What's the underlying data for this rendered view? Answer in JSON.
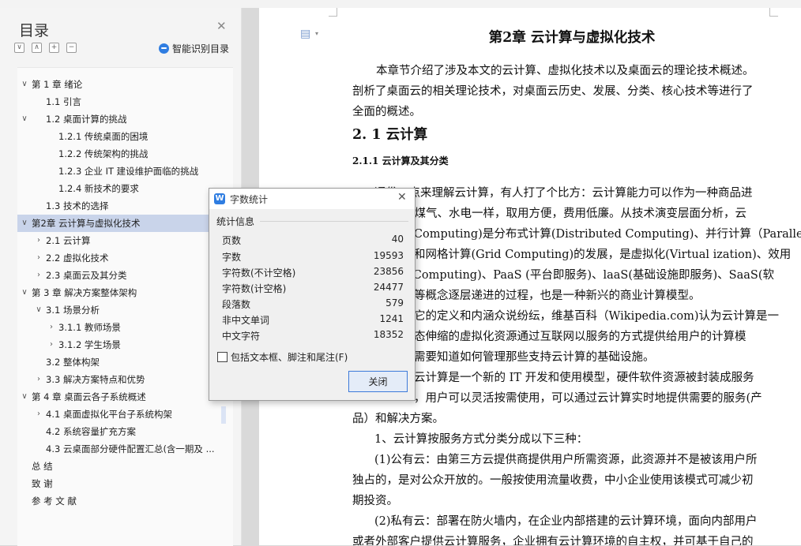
{
  "sidebar": {
    "title": "目录",
    "ai_button_label": "智能识别目录",
    "tools": [
      "∨",
      "∧",
      "+",
      "−"
    ],
    "items": [
      {
        "label": "第 1 章  绪论",
        "caret": "∨"
      },
      {
        "label": "1.1  引言",
        "caret": ""
      },
      {
        "label": "1.2  桌面计算的挑战",
        "caret": "∨"
      },
      {
        "label": "1.2.1  传统桌面的困境",
        "caret": ""
      },
      {
        "label": "1.2.2  传统架构的挑战",
        "caret": ""
      },
      {
        "label": "1.2.3  企业 IT 建设维护面临的挑战",
        "caret": ""
      },
      {
        "label": "1.2.4  新技术的要求",
        "caret": ""
      },
      {
        "label": "1.3  技术的选择",
        "caret": ""
      },
      {
        "label": "第2章  云计算与虚拟化技术",
        "caret": "∨"
      },
      {
        "label": "2.1  云计算",
        "caret": "›"
      },
      {
        "label": "2.2  虚拟化技术",
        "caret": "›"
      },
      {
        "label": "2.3  桌面云及其分类",
        "caret": "›"
      },
      {
        "label": "第 3 章  解决方案整体架构",
        "caret": "∨"
      },
      {
        "label": "3.1  场景分析",
        "caret": "∨"
      },
      {
        "label": "3.1.1 教师场景",
        "caret": "›"
      },
      {
        "label": "3.1.2 学生场景",
        "caret": "›"
      },
      {
        "label": "3.2 整体构架",
        "caret": ""
      },
      {
        "label": "3.3 解决方案特点和优势",
        "caret": "›"
      },
      {
        "label": "第 4 章  桌面云各子系统概述",
        "caret": "∨"
      },
      {
        "label": "4.1 桌面虚拟化平台子系统构架",
        "caret": "›"
      },
      {
        "label": "4.2 系统容量扩充方案",
        "caret": ""
      },
      {
        "label": "4.3 云桌面部分硬件配置汇总(含一期及 ...",
        "caret": ""
      },
      {
        "label": "总    结",
        "caret": ""
      },
      {
        "label": "致    谢",
        "caret": ""
      },
      {
        "label": "参  考  文  献",
        "caret": ""
      }
    ]
  },
  "document": {
    "chapter_title": "第2章  云计算与虚拟化技术",
    "intro_lines": [
      "本章节介绍了涉及本文的云计算、虚拟化技术以及桌面云的理论技术概述。",
      "剖析了桌面云的相关理论技术，对桌面云历史、发展、分类、核心技术等进行了",
      "全面的概述。"
    ],
    "section_heading": "2. 1    云计算",
    "subsection_heading": "2.1.1  云计算及其分类",
    "body_lines": [
      "通俗一点来理解云计算，有人打了个比方：云计算能力可以作为一种商品进",
      "像煤气、水电一样，取用方便，费用低廉。从技术演变层面分析，云",
      "d Computing)是分布式计算(Distributed Computing)、并行计算（Parallel",
      "和网格计算(Grid Computing)的发展，是虚拟化(Virtual ization)、效用",
      "y Computing)、PaaS (平台即服务)、laaS(基础设施即服务)、SaaS(软",
      "等概念逐层递进的过程，也是一种新兴的商业计算模型。",
      "它的定义和内涵众说纷纭，维基百科（Wikipedia.com)认为云计算是一",
      "态伸缩的虚拟化资源通过互联网以服务的方式提供给用户的计算模",
      "需要知道如何管理那些支持云计算的基础设施。",
      "云计算是一个新的 IT 开发和使用模型，硬件软件资源被封装成服务",
      "，用户可以灵活按需使用，可以通过云计算实时地提供需要的服务(产",
      "品）和解决方案。",
      "1、云计算按服务方式分类分成以下三种：",
      "(1)公有云：由第三方云提供商提供用户所需资源，此资源并不是被该用户所",
      "独占的，是对公众开放的。一般按使用流量收费，中小企业使用该模式可减少初",
      "期投资。",
      "(2)私有云：部署在防火墙内，在企业内部搭建的云计算环境，面向内部用户",
      "或者外部客户提供云计算服务，企业拥有云计算环境的自主权，并可基于自己的"
    ]
  },
  "dialog": {
    "title": "字数统计",
    "group_title": "统计信息",
    "stats": [
      {
        "label": "页数",
        "value": "40"
      },
      {
        "label": "字数",
        "value": "19593"
      },
      {
        "label": "字符数(不计空格)",
        "value": "23856"
      },
      {
        "label": "字符数(计空格)",
        "value": "24477"
      },
      {
        "label": "段落数",
        "value": "579"
      },
      {
        "label": "非中文单词",
        "value": "1241"
      },
      {
        "label": "中文字符",
        "value": "18352"
      }
    ],
    "checkbox_label": "包括文本框、脚注和尾注(F)",
    "close_button": "关闭"
  },
  "colors": {
    "selected_toc": "#c9d4ea",
    "accent": "#2f7de1"
  }
}
